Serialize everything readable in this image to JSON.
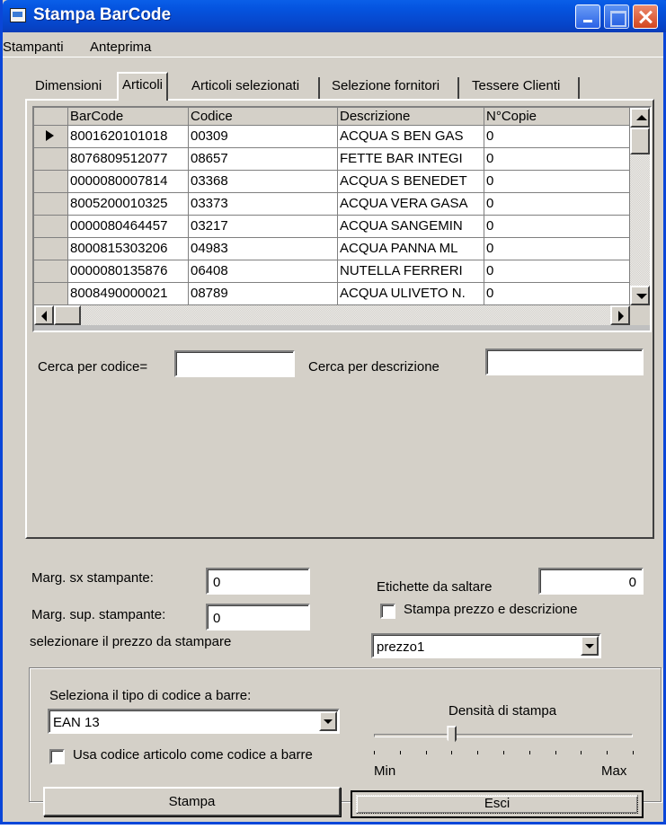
{
  "window": {
    "title": "Stampa BarCode"
  },
  "menu": {
    "items": [
      "Stampanti",
      "Anteprima"
    ]
  },
  "tabs": [
    "Dimensioni",
    "Articoli",
    "Articoli selezionati",
    "Selezione fornitori",
    "Tessere Clienti"
  ],
  "active_tab": "Articoli",
  "grid": {
    "columns": [
      "BarCode",
      "Codice",
      "Descrizione",
      "N°Copie"
    ],
    "rows": [
      [
        "8001620101018",
        "00309",
        "ACQUA S BEN GAS",
        "0"
      ],
      [
        "8076809512077",
        "08657",
        "FETTE BAR INTEGI",
        "0"
      ],
      [
        "0000080007814",
        "03368",
        "ACQUA S BENEDET",
        "0"
      ],
      [
        "8005200010325",
        "03373",
        "ACQUA VERA GASA",
        "0"
      ],
      [
        "0000080464457",
        "03217",
        "ACQUA SANGEMIN",
        "0"
      ],
      [
        "8000815303206",
        "04983",
        "ACQUA PANNA  ML",
        "0"
      ],
      [
        "0000080135876",
        "06408",
        "NUTELLA FERRERI",
        "0"
      ],
      [
        "8008490000021",
        "08789",
        "ACQUA ULIVETO N.",
        "0"
      ]
    ]
  },
  "search": {
    "code_label": "Cerca per codice=",
    "code_value": "",
    "desc_label": "Cerca per descrizione",
    "desc_value": ""
  },
  "settings": {
    "marg_sx_label": "Marg. sx stampante:",
    "marg_sx_value": "0",
    "marg_sup_label": "Marg. sup. stampante:",
    "marg_sup_value": "0",
    "price_select_label": "selezionare il prezzo da stampare",
    "price_select_value": "prezzo1",
    "skip_labels_label": "Etichette da saltare",
    "skip_labels_value": "0",
    "print_price_desc_label": "Stampa prezzo e descrizione"
  },
  "barcode": {
    "type_label": "Seleziona il tipo di codice a barre:",
    "type_value": "EAN 13",
    "use_code_label": "Usa codice articolo come codice a barre",
    "density_label": "Densità di stampa",
    "density_min": "Min",
    "density_max": "Max",
    "density_level": 0.3
  },
  "buttons": {
    "print": "Stampa",
    "exit": "Esci"
  }
}
